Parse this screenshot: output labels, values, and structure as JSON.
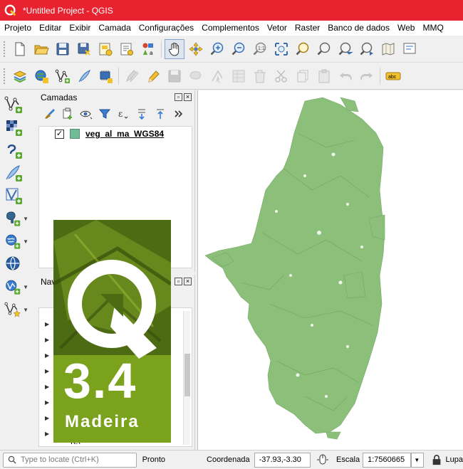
{
  "window": {
    "title": "*Untitled Project - QGIS"
  },
  "menu": [
    "Projeto",
    "Editar",
    "Exibir",
    "Camada",
    "Configurações",
    "Complementos",
    "Vetor",
    "Raster",
    "Banco de dados",
    "Web",
    "MMQ"
  ],
  "layers_panel": {
    "title": "Camadas",
    "layers": [
      {
        "name": "veg_al_ma_WGS84",
        "checked": true,
        "color": "#6fbc97"
      }
    ]
  },
  "browser_panel": {
    "title": "Navegador",
    "visible_item": "K:\\"
  },
  "splash": {
    "version": "3.4",
    "name": "Madeira",
    "bg_color": "#6a8f1c"
  },
  "map": {
    "feature_color": "#8cc07a"
  },
  "status": {
    "locator_placeholder": "Type to locate (Ctrl+K)",
    "ready": "Pronto",
    "coordinate_label": "Coordenada",
    "coordinate": "-37.93,-3.30",
    "scale_label": "Escala",
    "scale": "1:7560665",
    "magnifier_label": "Lupa"
  },
  "colors": {
    "titlebar": "#e8232f",
    "accent_green": "#5aa832",
    "accent_yellow": "#f2c12e"
  }
}
